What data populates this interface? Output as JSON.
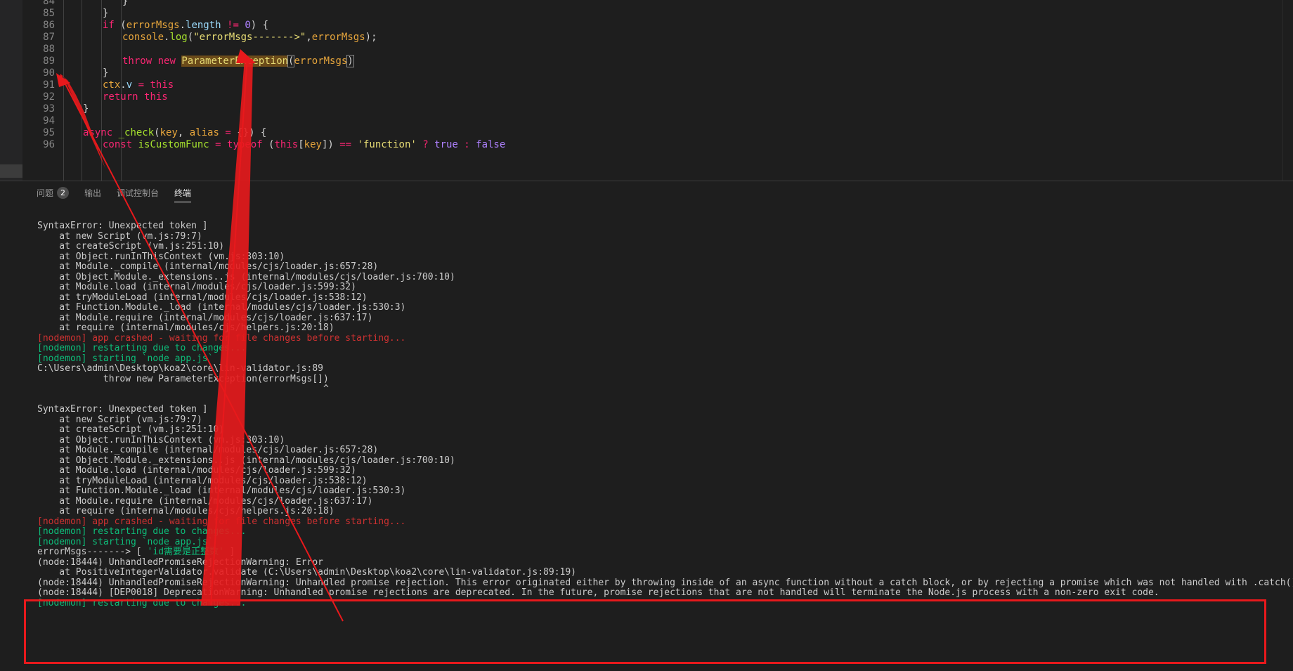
{
  "editor": {
    "lines": [
      {
        "num": "84",
        "indent": 3,
        "tokens": [
          {
            "t": "}",
            "c": "plain"
          }
        ]
      },
      {
        "num": "85",
        "indent": 2,
        "tokens": [
          {
            "t": "}",
            "c": "plain"
          }
        ]
      },
      {
        "num": "86",
        "indent": 2,
        "tokens": [
          {
            "t": "if",
            "c": "kw2"
          },
          {
            "t": " (",
            "c": "plain"
          },
          {
            "t": "errorMsgs",
            "c": "var"
          },
          {
            "t": ".",
            "c": "plain"
          },
          {
            "t": "length",
            "c": "prop"
          },
          {
            "t": " != ",
            "c": "kw2"
          },
          {
            "t": "0",
            "c": "num"
          },
          {
            "t": ") {",
            "c": "plain"
          }
        ]
      },
      {
        "num": "87",
        "indent": 3,
        "tokens": [
          {
            "t": "console",
            "c": "var"
          },
          {
            "t": ".",
            "c": "plain"
          },
          {
            "t": "log",
            "c": "fn"
          },
          {
            "t": "(",
            "c": "plain"
          },
          {
            "t": "\"errorMsgs------->\"",
            "c": "str"
          },
          {
            "t": ",",
            "c": "plain"
          },
          {
            "t": "errorMsgs",
            "c": "var"
          },
          {
            "t": ");",
            "c": "plain"
          }
        ]
      },
      {
        "num": "88",
        "indent": 0,
        "tokens": []
      },
      {
        "num": "89",
        "indent": 3,
        "tokens": [
          {
            "t": "throw",
            "c": "kw2"
          },
          {
            "t": " ",
            "c": "plain"
          },
          {
            "t": "new",
            "c": "kw2"
          },
          {
            "t": " ",
            "c": "plain"
          },
          {
            "t": "ParameterException",
            "c": "class"
          },
          {
            "t": "(",
            "c": "brack"
          },
          {
            "t": "errorMsgs",
            "c": "var"
          },
          {
            "t": ")",
            "c": "brack"
          }
        ]
      },
      {
        "num": "90",
        "indent": 2,
        "tokens": [
          {
            "t": "}",
            "c": "plain"
          }
        ]
      },
      {
        "num": "91",
        "indent": 2,
        "tokens": [
          {
            "t": "ctx",
            "c": "var"
          },
          {
            "t": ".",
            "c": "plain"
          },
          {
            "t": "v",
            "c": "prop"
          },
          {
            "t": " = ",
            "c": "kw2"
          },
          {
            "t": "this",
            "c": "kw2"
          }
        ]
      },
      {
        "num": "92",
        "indent": 2,
        "tokens": [
          {
            "t": "return",
            "c": "kw2"
          },
          {
            "t": " ",
            "c": "plain"
          },
          {
            "t": "this",
            "c": "kw2"
          }
        ]
      },
      {
        "num": "93",
        "indent": 1,
        "tokens": [
          {
            "t": "}",
            "c": "plain"
          }
        ]
      },
      {
        "num": "94",
        "indent": 0,
        "tokens": []
      },
      {
        "num": "95",
        "indent": 1,
        "tokens": [
          {
            "t": "async",
            "c": "kw2"
          },
          {
            "t": " ",
            "c": "plain"
          },
          {
            "t": "_check",
            "c": "fn"
          },
          {
            "t": "(",
            "c": "plain"
          },
          {
            "t": "key",
            "c": "var"
          },
          {
            "t": ", ",
            "c": "plain"
          },
          {
            "t": "alias",
            "c": "var"
          },
          {
            "t": " = ",
            "c": "kw2"
          },
          {
            "t": "{}) {",
            "c": "plain"
          }
        ]
      },
      {
        "num": "96",
        "indent": 2,
        "tokens": [
          {
            "t": "const",
            "c": "kw2"
          },
          {
            "t": " ",
            "c": "plain"
          },
          {
            "t": "isCustomFunc",
            "c": "fn"
          },
          {
            "t": " = ",
            "c": "kw2"
          },
          {
            "t": "typeof",
            "c": "kw2"
          },
          {
            "t": " (",
            "c": "plain"
          },
          {
            "t": "this",
            "c": "kw2"
          },
          {
            "t": "[",
            "c": "plain"
          },
          {
            "t": "key",
            "c": "var"
          },
          {
            "t": "]) ",
            "c": "plain"
          },
          {
            "t": "==",
            "c": "kw2"
          },
          {
            "t": " ",
            "c": "plain"
          },
          {
            "t": "'function'",
            "c": "str"
          },
          {
            "t": " ? ",
            "c": "kw2"
          },
          {
            "t": "true",
            "c": "bool"
          },
          {
            "t": " : ",
            "c": "kw2"
          },
          {
            "t": "false",
            "c": "bool"
          }
        ]
      }
    ]
  },
  "panel": {
    "tabs": [
      {
        "label": "问题",
        "badge": "2",
        "active": false
      },
      {
        "label": "输出",
        "badge": "",
        "active": false
      },
      {
        "label": "调试控制台",
        "badge": "",
        "active": false
      },
      {
        "label": "终端",
        "badge": "",
        "active": true
      }
    ],
    "terminal_lines": [
      {
        "text": "SyntaxError: Unexpected token ]",
        "color": "plain"
      },
      {
        "text": "    at new Script (vm.js:79:7)",
        "color": "plain"
      },
      {
        "text": "    at createScript (vm.js:251:10)",
        "color": "plain"
      },
      {
        "text": "    at Object.runInThisContext (vm.js:303:10)",
        "color": "plain"
      },
      {
        "text": "    at Module._compile (internal/modules/cjs/loader.js:657:28)",
        "color": "plain"
      },
      {
        "text": "    at Object.Module._extensions..js (internal/modules/cjs/loader.js:700:10)",
        "color": "plain"
      },
      {
        "text": "    at Module.load (internal/modules/cjs/loader.js:599:32)",
        "color": "plain"
      },
      {
        "text": "    at tryModuleLoad (internal/modules/cjs/loader.js:538:12)",
        "color": "plain"
      },
      {
        "text": "    at Function.Module._load (internal/modules/cjs/loader.js:530:3)",
        "color": "plain"
      },
      {
        "text": "    at Module.require (internal/modules/cjs/loader.js:637:17)",
        "color": "plain"
      },
      {
        "text": "    at require (internal/modules/cjs/helpers.js:20:18)",
        "color": "plain"
      },
      {
        "text": "[nodemon] app crashed - waiting for file changes before starting...",
        "color": "red"
      },
      {
        "text": "[nodemon] restarting due to changes...",
        "color": "green"
      },
      {
        "text": "[nodemon] starting `node app.js`",
        "color": "green"
      },
      {
        "text": "C:\\Users\\admin\\Desktop\\koa2\\core\\lin-validator.js:89",
        "color": "plain"
      },
      {
        "text": "            throw new ParameterException(errorMsgs[])",
        "color": "plain"
      },
      {
        "text": "                                                    ^",
        "color": "plain"
      },
      {
        "text": "",
        "color": "plain"
      },
      {
        "text": "SyntaxError: Unexpected token ]",
        "color": "plain"
      },
      {
        "text": "    at new Script (vm.js:79:7)",
        "color": "plain"
      },
      {
        "text": "    at createScript (vm.js:251:10)",
        "color": "plain"
      },
      {
        "text": "    at Object.runInThisContext (vm.js:303:10)",
        "color": "plain"
      },
      {
        "text": "    at Module._compile (internal/modules/cjs/loader.js:657:28)",
        "color": "plain"
      },
      {
        "text": "    at Object.Module._extensions..js (internal/modules/cjs/loader.js:700:10)",
        "color": "plain"
      },
      {
        "text": "    at Module.load (internal/modules/cjs/loader.js:599:32)",
        "color": "plain"
      },
      {
        "text": "    at tryModuleLoad (internal/modules/cjs/loader.js:538:12)",
        "color": "plain"
      },
      {
        "text": "    at Function.Module._load (internal/modules/cjs/loader.js:530:3)",
        "color": "plain"
      },
      {
        "text": "    at Module.require (internal/modules/cjs/loader.js:637:17)",
        "color": "plain"
      },
      {
        "text": "    at require (internal/modules/cjs/helpers.js:20:18)",
        "color": "plain"
      },
      {
        "text": "[nodemon] app crashed - waiting for file changes before starting...",
        "color": "red"
      },
      {
        "text": "[nodemon] restarting due to changes...",
        "color": "green"
      },
      {
        "text": "[nodemon] starting `node app.js`",
        "color": "green"
      },
      {
        "text": "errorMsgs-------> [ ",
        "color": "plain",
        "str": "'id需要是正整数'",
        "tail": " ]"
      },
      {
        "text": "(node:18444) UnhandledPromiseRejectionWarning: Error",
        "color": "plain"
      },
      {
        "text": "    at PositiveIntegerValidator.validate (C:\\Users\\admin\\Desktop\\koa2\\core\\lin-validator.js:89:19)",
        "color": "plain"
      },
      {
        "text": "(node:18444) UnhandledPromiseRejectionWarning: Unhandled promise rejection. This error originated either by throwing inside of an async function without a catch block, or by rejecting a promise which was not handled with .catch(). (rejection id: 1)",
        "color": "plain"
      },
      {
        "text": "(node:18444) [DEP0018] DeprecationWarning: Unhandled promise rejections are deprecated. In the future, promise rejections that are not handled will terminate the Node.js process with a non-zero exit code.",
        "color": "plain"
      },
      {
        "text": "[nodemon] restarting due to changes...",
        "color": "green"
      }
    ]
  },
  "colors": {
    "annotation_red": "#e8191c",
    "terminal_red": "#cd3131",
    "terminal_green": "#0dbc79"
  }
}
